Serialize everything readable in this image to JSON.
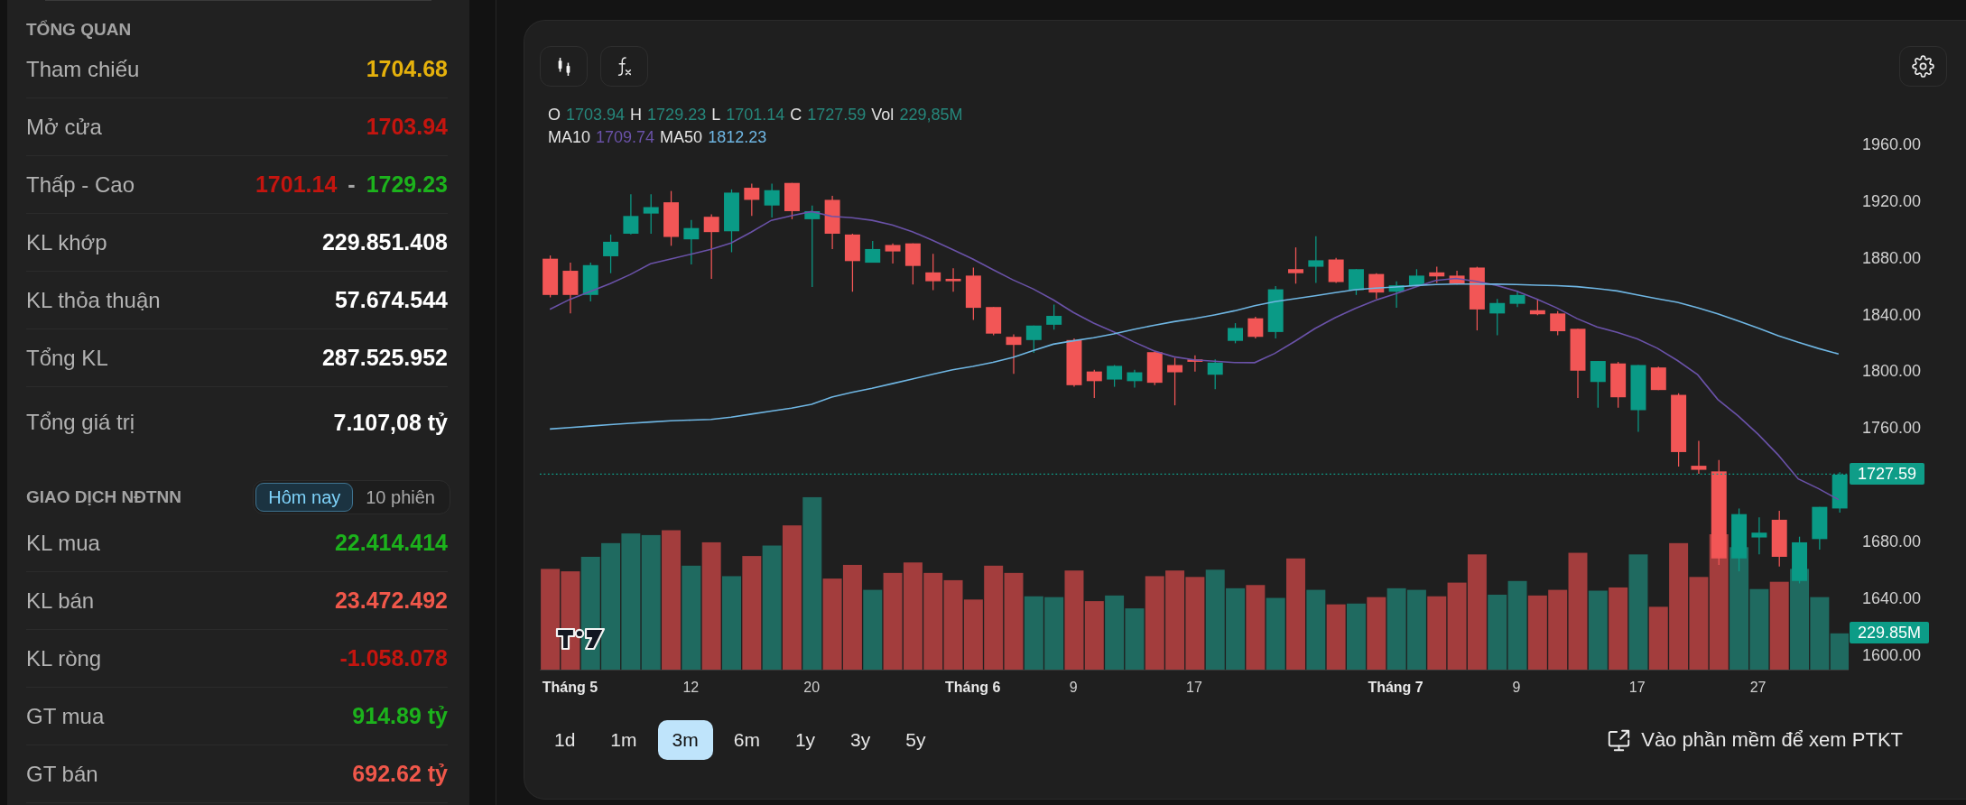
{
  "overview": {
    "title": "TỔNG QUAN",
    "rows": [
      {
        "label": "Tham chiếu",
        "values": [
          {
            "text": "1704.68",
            "color": "#e5b10c"
          }
        ]
      },
      {
        "label": "Mở cửa",
        "values": [
          {
            "text": "1703.94",
            "color": "#c4150f"
          }
        ]
      },
      {
        "label": "Thấp - Cao",
        "values": [
          {
            "text": "1701.14",
            "color": "#c4150f"
          },
          {
            "text": "-",
            "color": "#a6a6a6"
          },
          {
            "text": "1729.23",
            "color": "#1cb21c"
          }
        ]
      },
      {
        "label": "KL khớp",
        "values": [
          {
            "text": "229.851.408",
            "color": "#ffffff"
          }
        ]
      },
      {
        "label": "KL thỏa thuận",
        "values": [
          {
            "text": "57.674.544",
            "color": "#ffffff"
          }
        ]
      },
      {
        "label": "Tổng KL",
        "values": [
          {
            "text": "287.525.952",
            "color": "#ffffff"
          }
        ]
      },
      {
        "label": "Tổng giá trị",
        "values": [
          {
            "text": "7.107,08 tỷ",
            "color": "#ffffff"
          }
        ]
      }
    ]
  },
  "foreign_trading": {
    "title": "GIAO DỊCH NĐTNN",
    "tabs": [
      {
        "label": "Hôm nay",
        "selected": true
      },
      {
        "label": "10 phiên",
        "selected": false
      }
    ],
    "rows": [
      {
        "label": "KL mua",
        "values": [
          {
            "text": "22.414.414",
            "color": "#1cb21c"
          }
        ]
      },
      {
        "label": "KL bán",
        "values": [
          {
            "text": "23.472.492",
            "color": "#f0574a"
          }
        ]
      },
      {
        "label": "KL ròng",
        "values": [
          {
            "text": "-1.058.078",
            "color": "#c4150f"
          }
        ]
      },
      {
        "label": "GT mua",
        "values": [
          {
            "text": "914.89 tỷ",
            "color": "#1cb21c"
          }
        ]
      },
      {
        "label": "GT bán",
        "values": [
          {
            "text": "692.62 tỷ",
            "color": "#f0574a"
          }
        ]
      }
    ]
  },
  "chart": {
    "legend": [
      {
        "label": "O",
        "value": "1703.94",
        "color": "#26877c"
      },
      {
        "label": "H",
        "value": "1729.23",
        "color": "#26877c"
      },
      {
        "label": "L",
        "value": "1701.14",
        "color": "#26877c"
      },
      {
        "label": "C",
        "value": "1727.59",
        "color": "#26877c"
      },
      {
        "label": "Vol",
        "value": "229,85M",
        "color": "#26877c"
      }
    ],
    "ma_legend": [
      {
        "label": "MA10",
        "value": "1709.74"
      },
      {
        "label": "MA50",
        "value": "1812.23"
      }
    ],
    "chart_data": {
      "type": "line",
      "categories": [
        null,
        "Tháng 5",
        null,
        null,
        null,
        null,
        null,
        "12",
        null,
        null,
        null,
        null,
        null,
        "20",
        null,
        null,
        null,
        null,
        null,
        null,
        null,
        "Tháng 6",
        null,
        null,
        null,
        null,
        "9",
        null,
        null,
        null,
        null,
        null,
        "17",
        null,
        null,
        null,
        null,
        null,
        null,
        null,
        null,
        null,
        "Tháng 7",
        null,
        null,
        null,
        null,
        null,
        "9",
        null,
        null,
        null,
        null,
        null,
        "17",
        null,
        null,
        null,
        null,
        null,
        "27",
        null,
        null,
        null,
        null
      ],
      "ylim": [
        1600,
        1960
      ],
      "series": [
        {
          "color": "#6a52a8",
          "values": [
            1843.6,
            1850.7,
            1856.2,
            1861.8,
            1868.2,
            1875.8,
            1879.1,
            1882.4,
            1885.9,
            1890.4,
            1898.0,
            1906.3,
            1909.6,
            1912.5,
            1909.1,
            1908.1,
            1906.3,
            1903.0,
            1898.3,
            1892.3,
            1885.7,
            1879.0,
            1871.6,
            1864.4,
            1858.0,
            1850.3,
            1841.4,
            1834.0,
            1827.8,
            1820.7,
            1814.4,
            1810.2,
            1808.1,
            1807.1,
            1806.2,
            1806.1,
            1812.6,
            1821.1,
            1830.1,
            1837.7,
            1844.3,
            1850.0,
            1854.7,
            1859.4,
            1864.0,
            1865.4,
            1863.3,
            1860.6,
            1856.5,
            1851.0,
            1844.7,
            1837.2,
            1831.3,
            1827.4,
            1822.8,
            1816.3,
            1807.6,
            1797.7,
            1780.2,
            1768.8,
            1755.7,
            1741.1,
            1724.3,
            1717.5,
            1709.7
          ]
        },
        {
          "color": "#6fb6e3",
          "values": [
            1759.4,
            1760.4,
            1761.5,
            1762.5,
            1763.5,
            1764.3,
            1765.2,
            1765.7,
            1766.2,
            1767.8,
            1769.9,
            1772.0,
            1774.1,
            1776.8,
            1781.9,
            1785.2,
            1788.1,
            1791.3,
            1794.6,
            1797.9,
            1801.1,
            1803.5,
            1806.3,
            1809.8,
            1814.5,
            1819.1,
            1821.5,
            1823.6,
            1826.3,
            1829.5,
            1832.4,
            1835.0,
            1837.1,
            1839.7,
            1842.6,
            1846.2,
            1849.0,
            1851.1,
            1853.2,
            1855.4,
            1857.5,
            1858.6,
            1859.4,
            1860.4,
            1861.1,
            1861.5,
            1861.5,
            1861.4,
            1861.1,
            1860.7,
            1860.3,
            1859.6,
            1858.3,
            1856.6,
            1853.8,
            1851.1,
            1848.6,
            1844.8,
            1840.5,
            1835.5,
            1830.4,
            1825.1,
            1820.4,
            1816.1,
            1812.2
          ]
        }
      ],
      "ref_lines": [
        {
          "axis": "y",
          "value": 1727.59,
          "label": "1727.59",
          "color": "#0f9d88"
        }
      ],
      "yticks": [
        {
          "value": 1960,
          "label": "1960.00"
        },
        {
          "value": 1920,
          "label": "1920.00"
        },
        {
          "value": 1880,
          "label": "1880.00"
        },
        {
          "value": 1840,
          "label": "1840.00"
        },
        {
          "value": 1800,
          "label": "1800.00"
        },
        {
          "value": 1760,
          "label": "1760.00"
        },
        {
          "value": 1680,
          "label": "1680.00"
        },
        {
          "value": 1640,
          "label": "1640.00"
        },
        {
          "value": 1600,
          "label": "1600.00"
        }
      ]
    },
    "x_label_styles": [
      {
        "kind": "month"
      },
      {
        "kind": "day"
      },
      {
        "kind": "day"
      },
      {
        "kind": "month"
      },
      {
        "kind": "day"
      },
      {
        "kind": "day"
      },
      {
        "kind": "month"
      },
      {
        "kind": "day"
      },
      {
        "kind": "day"
      },
      {
        "kind": "day"
      }
    ],
    "volume_tag": "229.85M",
    "timeframes": [
      {
        "label": "1d",
        "selected": false
      },
      {
        "label": "1m",
        "selected": false
      },
      {
        "label": "3m",
        "selected": true
      },
      {
        "label": "6m",
        "selected": false
      },
      {
        "label": "1y",
        "selected": false
      },
      {
        "label": "3y",
        "selected": false
      },
      {
        "label": "5y",
        "selected": false
      }
    ],
    "open_app_link": "Vào phần mềm để xem PTKT"
  }
}
